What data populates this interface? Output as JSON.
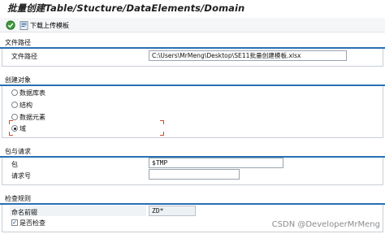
{
  "window": {
    "title": "批量创建Table/Stucture/DataElements/Domain"
  },
  "toolbar": {
    "download_label": "下载上传模板"
  },
  "sections": {
    "file_path": {
      "header": "文件路径",
      "field_label": "文件路径",
      "field_value": "C:\\Users\\MrMeng\\Desktop\\SE11批量创建模板.xlsx"
    },
    "create_object": {
      "header": "创建对象",
      "options": [
        {
          "label": "数据库表",
          "selected": false
        },
        {
          "label": "结构",
          "selected": false
        },
        {
          "label": "数据元素",
          "selected": false
        },
        {
          "label": "域",
          "selected": true
        }
      ]
    },
    "package_request": {
      "header": "包与请求",
      "package_label": "包",
      "package_value": "$TMP",
      "request_label": "请求号",
      "request_value": ""
    },
    "check_rules": {
      "header": "检查规则",
      "prefix_label": "命名前辍",
      "prefix_value": "ZD*",
      "check_label": "是否检查",
      "check_checked": true,
      "check_mark": "✓"
    }
  },
  "watermark": "CSDN @DeveloperMrMeng",
  "colors": {
    "section_line": "#2a6fb3",
    "focus_corner": "#d24a2a",
    "toolbar_bg": "#f4f6f8"
  },
  "icons": {
    "execute": "execute-icon",
    "download": "download-template-icon"
  }
}
